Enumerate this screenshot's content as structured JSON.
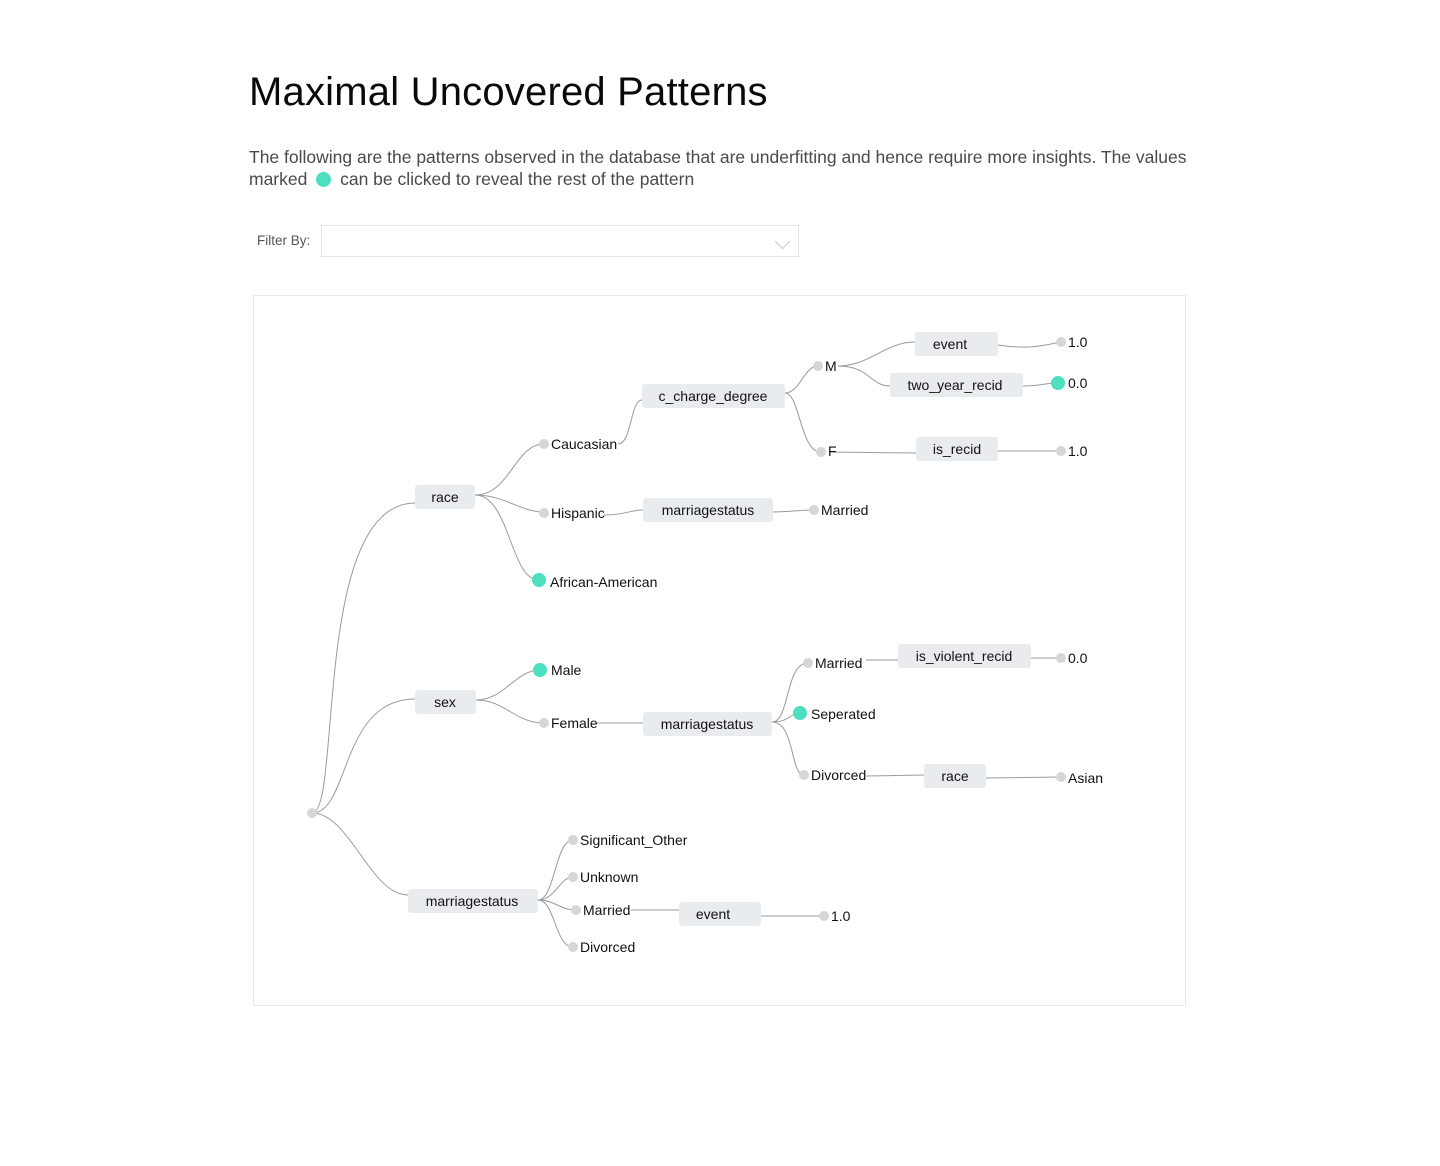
{
  "page": {
    "title": "Maximal Uncovered Patterns",
    "description_before": "The following are the patterns observed in the database that are underfitting and hence require more insights. The values marked",
    "description_after": "can be clicked to reveal the rest of the pattern",
    "marker_color": "#4ddfc0"
  },
  "filter": {
    "label": "Filter By:",
    "selected": ""
  },
  "tree": {
    "race": "race",
    "caucasian": "Caucasian",
    "c_charge_degree": "c_charge_degree",
    "m": "M",
    "m_event": "event",
    "m_event_val": "1.0",
    "m_two_year_recid": "two_year_recid",
    "m_two_year_recid_val": "0.0",
    "f": "F",
    "f_is_recid": "is_recid",
    "f_is_recid_val": "1.0",
    "hispanic": "Hispanic",
    "hispanic_marriagestatus": "marriagestatus",
    "hispanic_married": "Married",
    "african_american": "African-American",
    "sex": "sex",
    "male": "Male",
    "female": "Female",
    "female_marriagestatus": "marriagestatus",
    "female_married": "Married",
    "is_violent_recid": "is_violent_recid",
    "is_violent_recid_val": "0.0",
    "seperated": "Seperated",
    "divorced": "Divorced",
    "divorced_race": "race",
    "asian": "Asian",
    "marriagestatus": "marriagestatus",
    "significant_other": "Significant_Other",
    "unknown": "Unknown",
    "ms_married": "Married",
    "ms_event": "event",
    "ms_event_val": "1.0",
    "ms_divorced": "Divorced"
  }
}
